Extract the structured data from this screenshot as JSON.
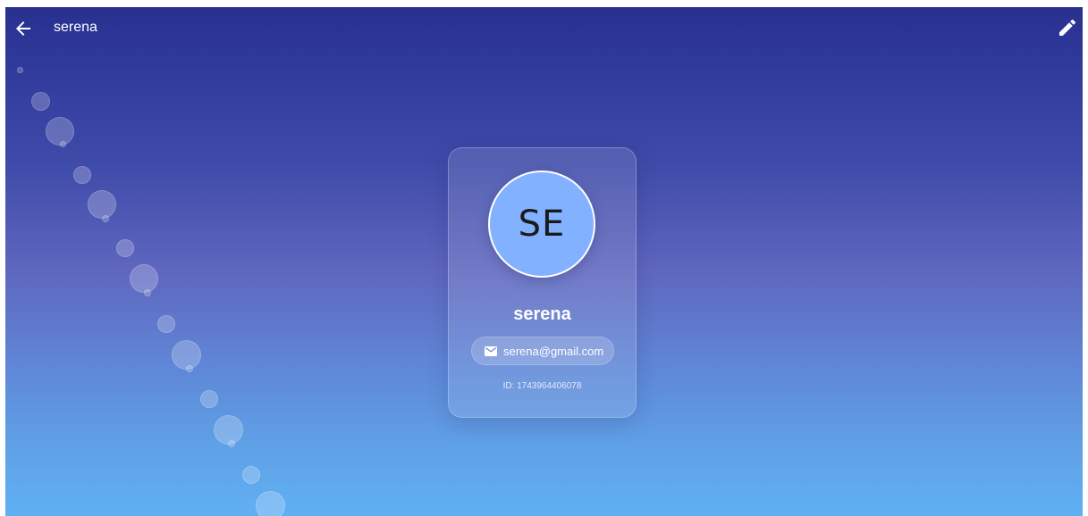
{
  "app_bar": {
    "title": "serena",
    "back_icon": "arrow-back-icon",
    "edit_icon": "pencil-icon"
  },
  "profile": {
    "initials": "SE",
    "name": "serena",
    "email": "serena@gmail.com",
    "email_icon": "mail-icon",
    "id_text": "ID: 1743964406078"
  },
  "colors": {
    "gradient_top": "#28308f",
    "gradient_mid": "#5f67bf",
    "gradient_bottom": "#60b0f3",
    "avatar_background": "#82b1ff",
    "text_primary": "#ffffff"
  }
}
